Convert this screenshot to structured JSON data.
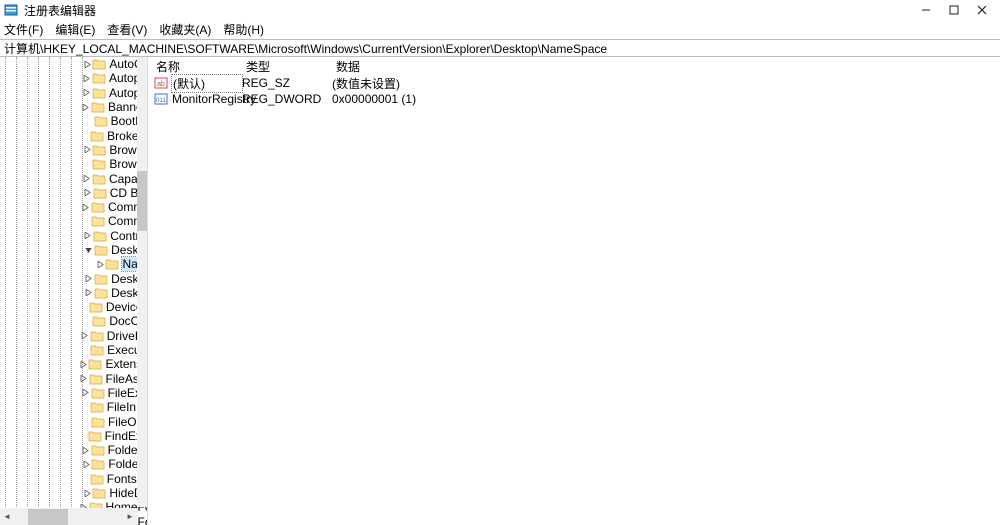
{
  "window": {
    "title": "注册表编辑器"
  },
  "menu": {
    "file": "文件(F)",
    "edit": "编辑(E)",
    "view": "查看(V)",
    "favorites": "收藏夹(A)",
    "help": "帮助(H)"
  },
  "address": "计算机\\HKEY_LOCAL_MACHINE\\SOFTWARE\\Microsoft\\Windows\\CurrentVersion\\Explorer\\Desktop\\NameSpace",
  "tree": [
    {
      "indent": 8,
      "arrow": "right",
      "label": "AutoCo"
    },
    {
      "indent": 8,
      "arrow": "right",
      "label": "Autopla"
    },
    {
      "indent": 8,
      "arrow": "right",
      "label": "Autopla"
    },
    {
      "indent": 8,
      "arrow": "right",
      "label": "Banner!"
    },
    {
      "indent": 8,
      "arrow": "",
      "label": "BootLo"
    },
    {
      "indent": 8,
      "arrow": "",
      "label": "BrokerE"
    },
    {
      "indent": 8,
      "arrow": "right",
      "label": "Browse"
    },
    {
      "indent": 8,
      "arrow": "",
      "label": "Browse"
    },
    {
      "indent": 8,
      "arrow": "right",
      "label": "Capabil"
    },
    {
      "indent": 8,
      "arrow": "right",
      "label": "CD Bur"
    },
    {
      "indent": 8,
      "arrow": "right",
      "label": "Comma"
    },
    {
      "indent": 8,
      "arrow": "",
      "label": "Commo"
    },
    {
      "indent": 8,
      "arrow": "right",
      "label": "Control"
    },
    {
      "indent": 8,
      "arrow": "down",
      "label": "Deskto"
    },
    {
      "indent": 9,
      "arrow": "right",
      "label": "Nam",
      "selected": true
    },
    {
      "indent": 8,
      "arrow": "right",
      "label": "Deskto"
    },
    {
      "indent": 8,
      "arrow": "right",
      "label": "Deskto"
    },
    {
      "indent": 8,
      "arrow": "",
      "label": "DeviceU"
    },
    {
      "indent": 8,
      "arrow": "",
      "label": "DocObj"
    },
    {
      "indent": 8,
      "arrow": "right",
      "label": "DriveIco"
    },
    {
      "indent": 8,
      "arrow": "",
      "label": "Execute"
    },
    {
      "indent": 8,
      "arrow": "right",
      "label": "Extensio"
    },
    {
      "indent": 8,
      "arrow": "right",
      "label": "FileAsso"
    },
    {
      "indent": 8,
      "arrow": "right",
      "label": "FileExts"
    },
    {
      "indent": 8,
      "arrow": "",
      "label": "FileInUs"
    },
    {
      "indent": 8,
      "arrow": "",
      "label": "FileOpe"
    },
    {
      "indent": 8,
      "arrow": "",
      "label": "FindExte"
    },
    {
      "indent": 8,
      "arrow": "right",
      "label": "FolderD"
    },
    {
      "indent": 8,
      "arrow": "right",
      "label": "FolderT"
    },
    {
      "indent": 8,
      "arrow": "",
      "label": "FontsFo"
    },
    {
      "indent": 8,
      "arrow": "right",
      "label": "HideDe"
    },
    {
      "indent": 8,
      "arrow": "right",
      "label": "HomeFo"
    },
    {
      "indent": 8,
      "arrow": "right",
      "label": "HomeFo"
    }
  ],
  "columns": {
    "name": "名称",
    "type": "类型",
    "data": "数据"
  },
  "values": [
    {
      "icon": "string",
      "name": "(默认)",
      "selected": true,
      "type": "REG_SZ",
      "data": "(数值未设置)"
    },
    {
      "icon": "binary",
      "name": "MonitorRegistry",
      "selected": false,
      "type": "REG_DWORD",
      "data": "0x00000001 (1)"
    }
  ]
}
